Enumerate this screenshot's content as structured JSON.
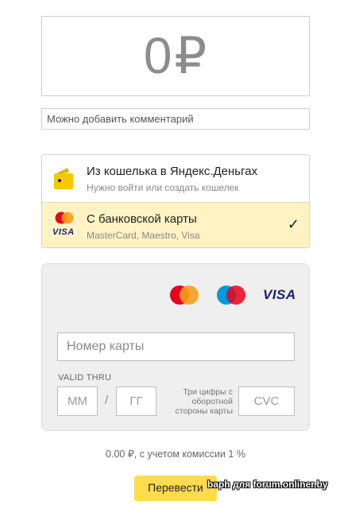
{
  "amount": {
    "value": "0",
    "currency": "₽"
  },
  "comment": {
    "placeholder": "Можно добавить комментарий"
  },
  "methods": [
    {
      "title": "Из кошелька в Яндекс.Деньгах",
      "subtitle": "Нужно войти или создать кошелек",
      "icon": "wallet-icon",
      "selected": false
    },
    {
      "title": "С банковской карты",
      "subtitle": "MasterCard, Maestro, Visa",
      "icon": "mastercard-visa-icon",
      "selected": true,
      "check": "✓"
    }
  ],
  "card_form": {
    "brands": {
      "mastercard": "MasterCard",
      "maestro": "Maestro",
      "visa": "VISA"
    },
    "card_number_placeholder": "Номер карты",
    "valid_thru_label": "VALID THRU",
    "mm_placeholder": "ММ",
    "separator": "/",
    "yy_placeholder": "ГГ",
    "cvc_hint": "Три цифры с оборотной стороны карты",
    "cvc_placeholder": "CVC"
  },
  "commission": "0.00 ₽, с учетом комиссии 1 %",
  "submit_label": "Перевести",
  "watermark": "baph для forum.onliner.by",
  "colors": {
    "accent": "#ffdb4d",
    "selected_bg": "#fff3c4",
    "form_bg": "#efefef"
  }
}
